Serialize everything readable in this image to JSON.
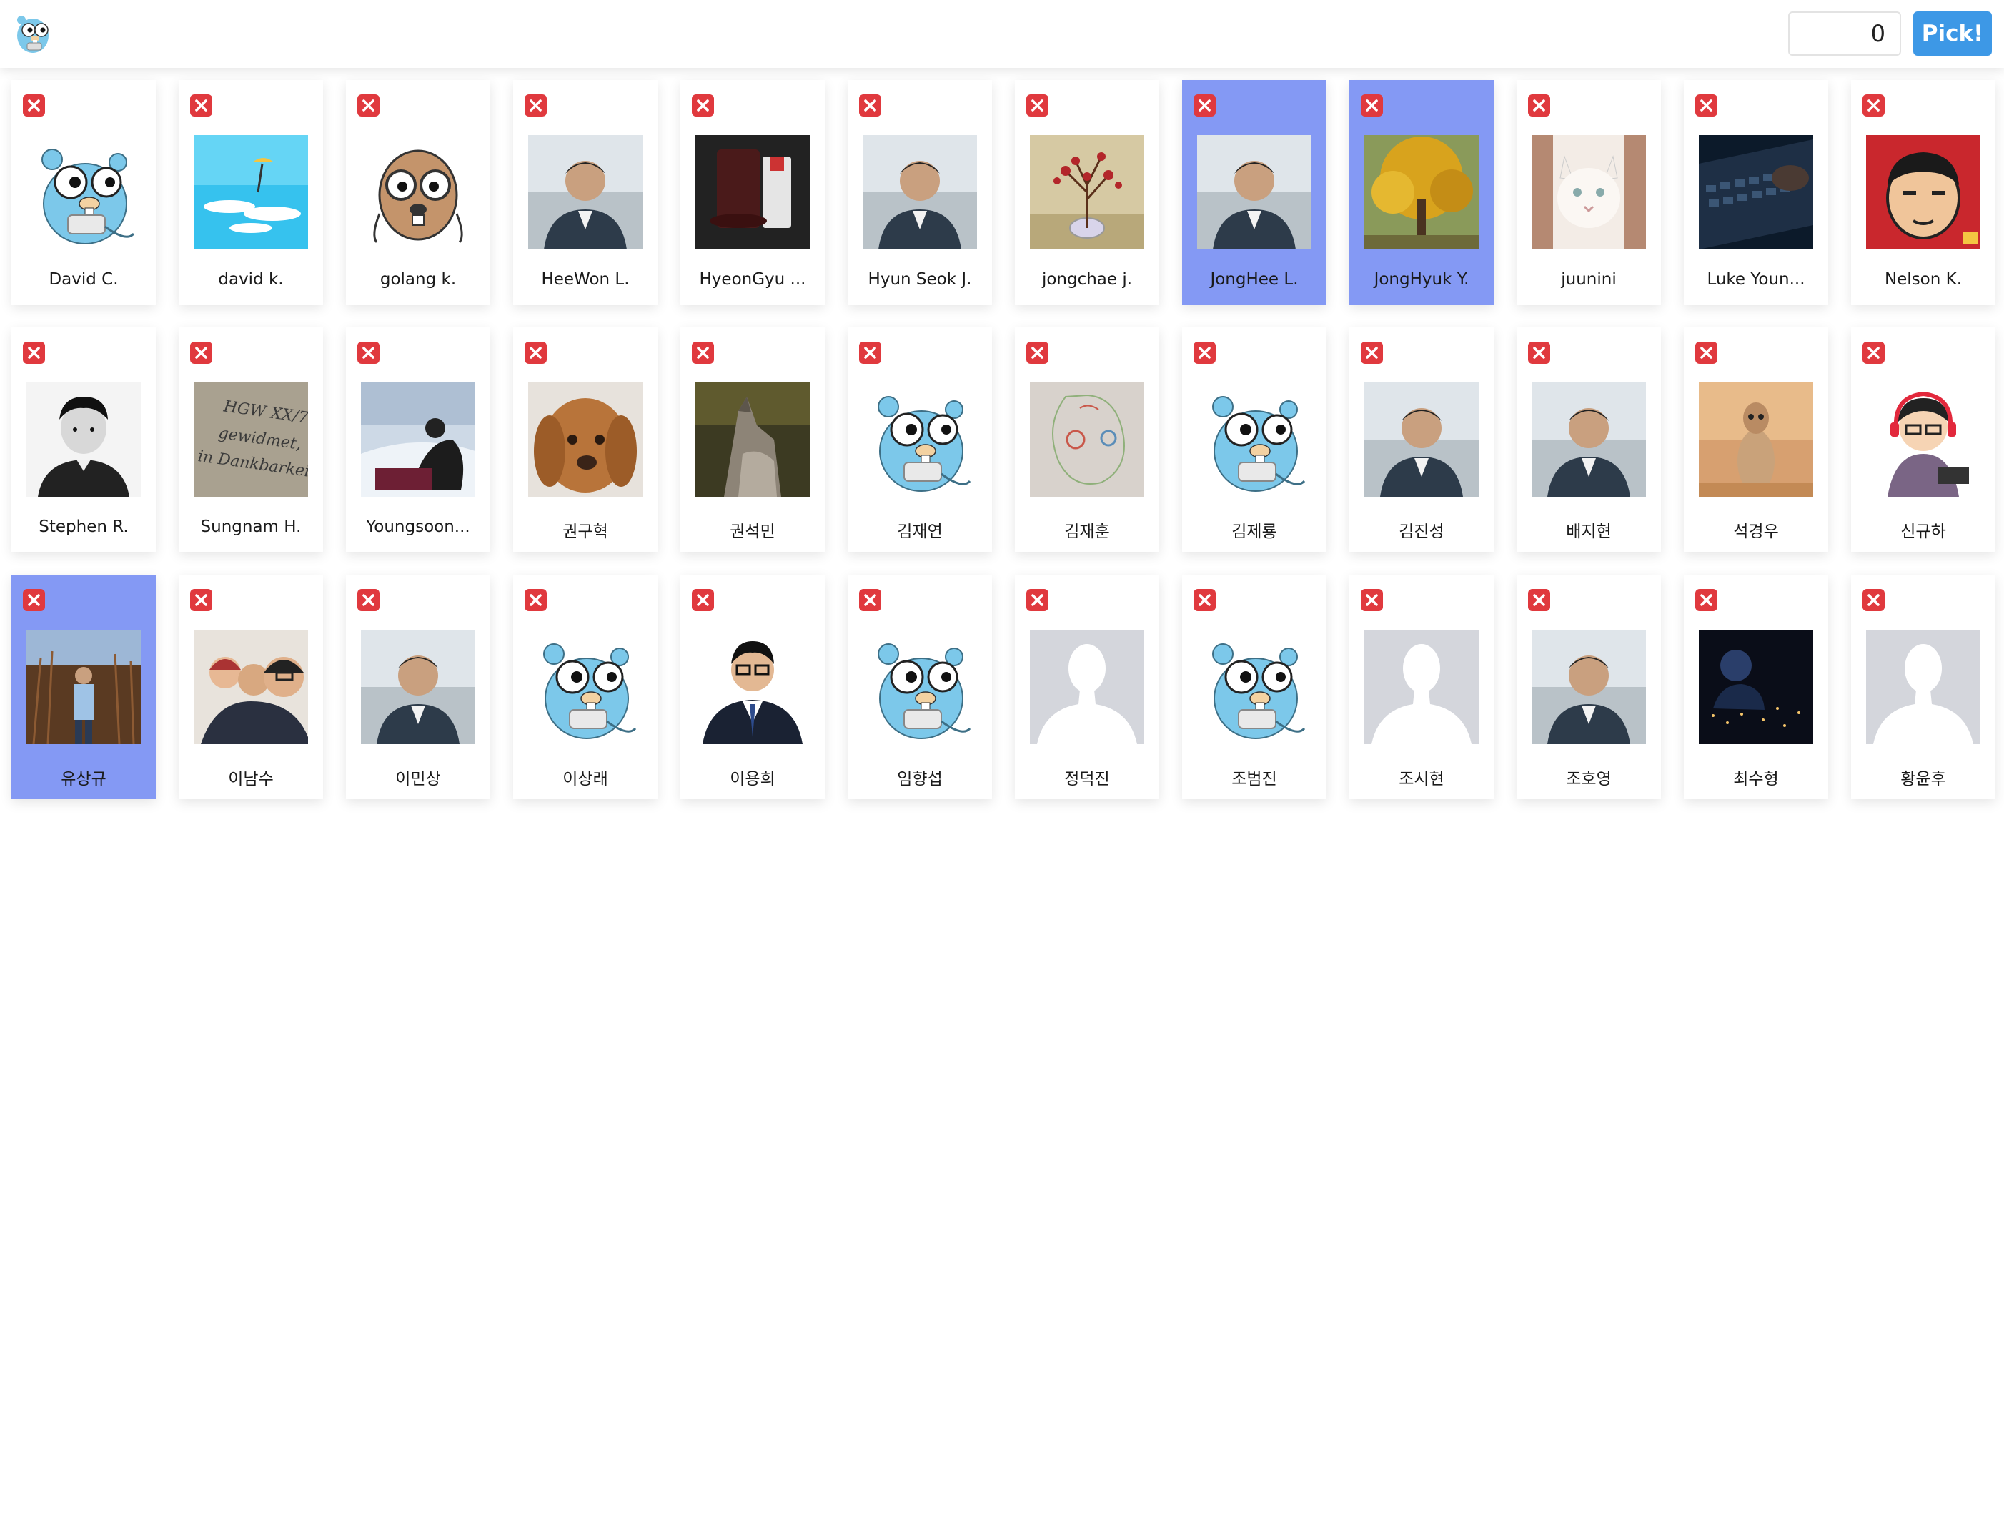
{
  "header": {
    "logo_icon": "gopher-icon",
    "count_value": "0",
    "pick_label": "Pick!"
  },
  "colors": {
    "pick_button": "#3d98e6",
    "selected_card": "#8499f4",
    "remove_button": "#e0393e"
  },
  "members": [
    {
      "name": "David C.",
      "avatar": "gopher",
      "selected": false
    },
    {
      "name": "david k.",
      "avatar": "sky",
      "selected": false
    },
    {
      "name": "golang k.",
      "avatar": "goggles",
      "selected": false
    },
    {
      "name": "HeeWon L.",
      "avatar": "person",
      "selected": false
    },
    {
      "name": "HyeonGyu ...",
      "avatar": "dark",
      "selected": false
    },
    {
      "name": "Hyun Seok J.",
      "avatar": "person",
      "selected": false
    },
    {
      "name": "jongchae j.",
      "avatar": "plant",
      "selected": false
    },
    {
      "name": "JongHee L.",
      "avatar": "person",
      "selected": true
    },
    {
      "name": "JongHyuk Y.",
      "avatar": "tree",
      "selected": true
    },
    {
      "name": "juunini",
      "avatar": "cat",
      "selected": false
    },
    {
      "name": "Luke Youn...",
      "avatar": "keyboard",
      "selected": false
    },
    {
      "name": "Nelson K.",
      "avatar": "cartoon",
      "selected": false
    },
    {
      "name": "Stephen R.",
      "avatar": "bw",
      "selected": false
    },
    {
      "name": "Sungnam H.",
      "avatar": "text",
      "selected": false
    },
    {
      "name": "Youngsoon...",
      "avatar": "winter",
      "selected": false
    },
    {
      "name": "권구혁",
      "avatar": "dog",
      "selected": false
    },
    {
      "name": "권석민",
      "avatar": "wolf",
      "selected": false
    },
    {
      "name": "김재연",
      "avatar": "gopher",
      "selected": false
    },
    {
      "name": "김재훈",
      "avatar": "sketch",
      "selected": false
    },
    {
      "name": "김제룡",
      "avatar": "gopher",
      "selected": false
    },
    {
      "name": "김진성",
      "avatar": "person",
      "selected": false
    },
    {
      "name": "배지현",
      "avatar": "person",
      "selected": false
    },
    {
      "name": "석경우",
      "avatar": "meerkat",
      "selected": false
    },
    {
      "name": "신규하",
      "avatar": "cartoon2",
      "selected": false
    },
    {
      "name": "유상규",
      "avatar": "field",
      "selected": true
    },
    {
      "name": "이남수",
      "avatar": "group",
      "selected": false
    },
    {
      "name": "이민상",
      "avatar": "person",
      "selected": false
    },
    {
      "name": "이상래",
      "avatar": "gopher",
      "selected": false
    },
    {
      "name": "이용희",
      "avatar": "suit",
      "selected": false
    },
    {
      "name": "임향섭",
      "avatar": "gopher",
      "selected": false
    },
    {
      "name": "정덕진",
      "avatar": "placeholder",
      "selected": false
    },
    {
      "name": "조범진",
      "avatar": "gopher",
      "selected": false
    },
    {
      "name": "조시현",
      "avatar": "placeholder",
      "selected": false
    },
    {
      "name": "조호영",
      "avatar": "person",
      "selected": false
    },
    {
      "name": "최수형",
      "avatar": "night",
      "selected": false
    },
    {
      "name": "황윤후",
      "avatar": "placeholder",
      "selected": false
    }
  ]
}
